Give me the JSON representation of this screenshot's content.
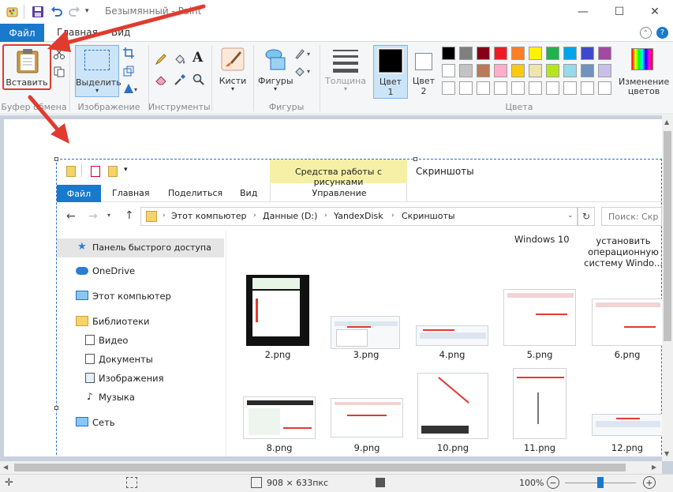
{
  "app": {
    "title": "Безымянный - Paint"
  },
  "menu": {
    "file": "Файл",
    "home": "Главная",
    "view": "Вид"
  },
  "ribbon": {
    "clipboard": {
      "paste": "Вставить",
      "group": "Буфер обмена"
    },
    "image": {
      "select": "Выделить",
      "group": "Изображение"
    },
    "tools": {
      "group": "Инструменты"
    },
    "brushes": {
      "label": "Кисти"
    },
    "shapes": {
      "label": "Фигуры",
      "group": "Фигуры"
    },
    "size": {
      "label": "Толщина"
    },
    "color1": {
      "line1": "Цвет",
      "line2": "1"
    },
    "color2": {
      "line1": "Цвет",
      "line2": "2"
    },
    "colors": {
      "group": "Цвета",
      "edit_line1": "Изменение",
      "edit_line2": "цветов"
    },
    "palette_row1": [
      "#000000",
      "#7f7f7f",
      "#880015",
      "#ed1c24",
      "#ff7f27",
      "#fff200",
      "#22b14c",
      "#00a2e8",
      "#3f48cc",
      "#a349a4"
    ],
    "palette_row2": [
      "#ffffff",
      "#c3c3c3",
      "#b97a57",
      "#ffaec9",
      "#ffc90e",
      "#efe4b0",
      "#b5e61d",
      "#99d9ea",
      "#7092be",
      "#c8bfe7"
    ]
  },
  "explorer": {
    "context_tab": "Средства работы с рисунками",
    "context_sub": "Управление",
    "title": "Скриншоты",
    "tabs": [
      "Файл",
      "Главная",
      "Поделиться",
      "Вид"
    ],
    "breadcrumbs": [
      "Этот компьютер",
      "Данные (D:)",
      "YandexDisk",
      "Скриншоты"
    ],
    "search_placeholder": "Поиск: Скр",
    "nav": [
      "Панель быстрого доступа",
      "OneDrive",
      "Этот компьютер",
      "Библиотеки",
      "Видео",
      "Документы",
      "Изображения",
      "Музыка",
      "Сеть"
    ],
    "top_labels": [
      "Windows 10",
      "установить",
      "операционную",
      "систему Windo..."
    ],
    "files_row1": [
      "2.png",
      "3.png",
      "4.png",
      "5.png",
      "6.png"
    ],
    "files_row2": [
      "8.png",
      "9.png",
      "10.png",
      "11.png",
      "12.png"
    ]
  },
  "status": {
    "size": "908 × 633пкс",
    "zoom": "100%"
  },
  "colors": {
    "accent": "#1979ca",
    "arrow": "#e03b2f",
    "highlight": "#cce4f7"
  }
}
